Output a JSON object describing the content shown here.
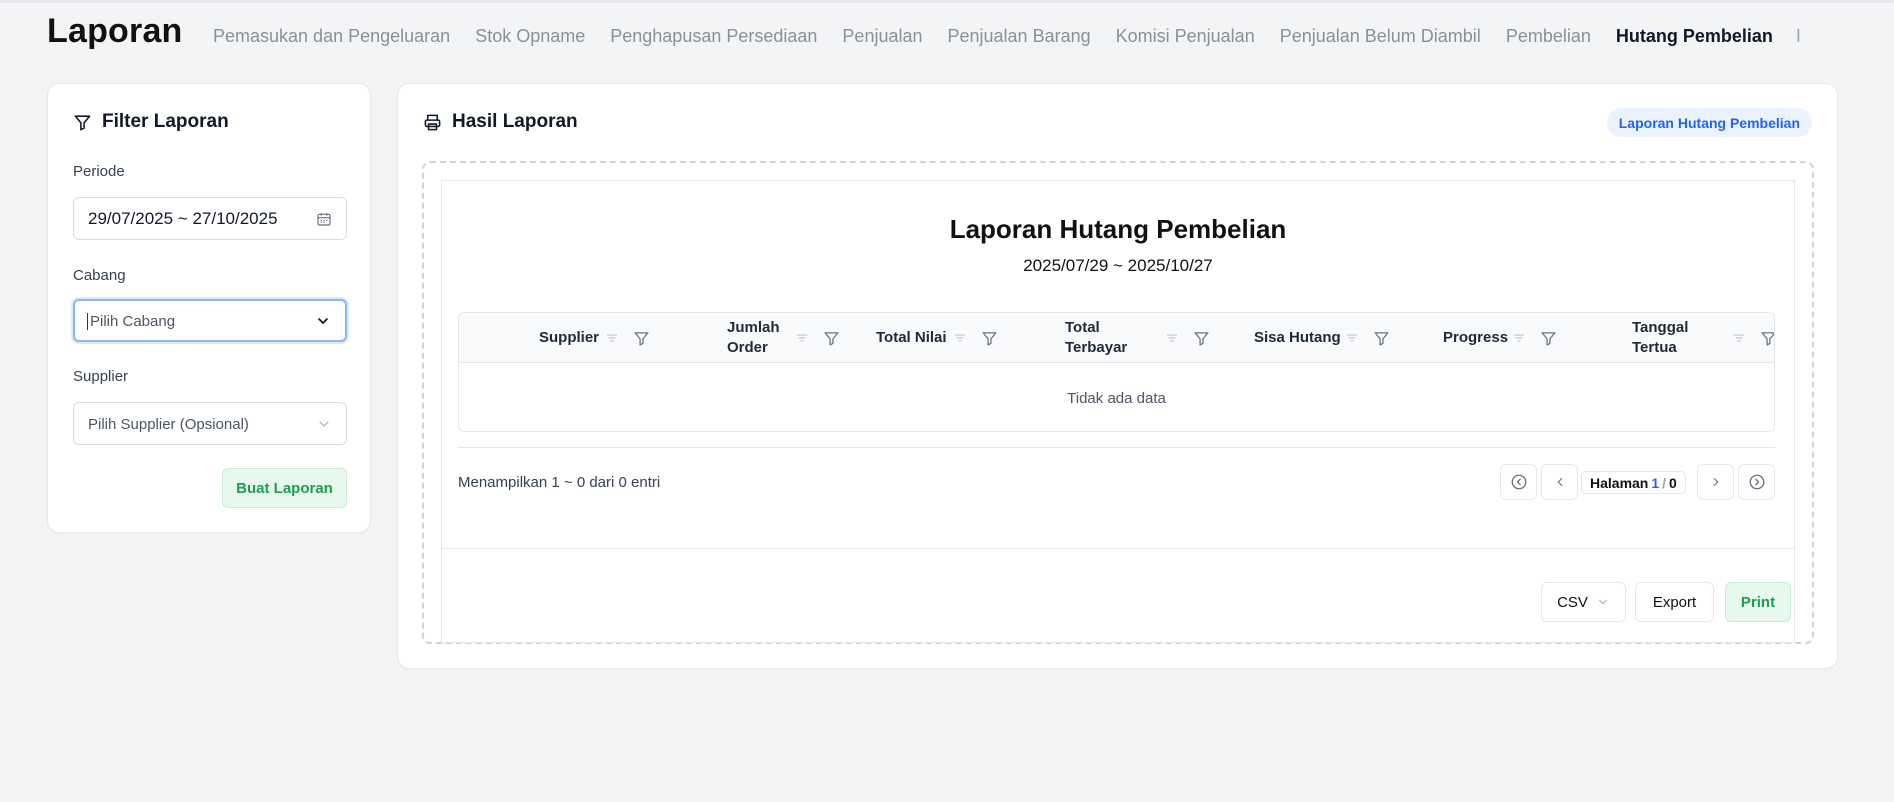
{
  "header": {
    "title": "Laporan",
    "nav": [
      {
        "label": "Pemasukan dan Pengeluaran",
        "active": false
      },
      {
        "label": "Stok Opname",
        "active": false
      },
      {
        "label": "Penghapusan Persediaan",
        "active": false
      },
      {
        "label": "Penjualan",
        "active": false
      },
      {
        "label": "Penjualan Barang",
        "active": false
      },
      {
        "label": "Komisi Penjualan",
        "active": false
      },
      {
        "label": "Penjualan Belum Diambil",
        "active": false
      },
      {
        "label": "Pembelian",
        "active": false
      },
      {
        "label": "Hutang Pembelian",
        "active": true
      }
    ],
    "nav_overflow": "I"
  },
  "filter": {
    "title": "Filter Laporan",
    "period_label": "Periode",
    "period_value": "29/07/2025 ~ 27/10/2025",
    "branch_label": "Cabang",
    "branch_placeholder": "Pilih Cabang",
    "supplier_label": "Supplier",
    "supplier_placeholder": "Pilih Supplier (Opsional)",
    "submit_label": "Buat Laporan"
  },
  "result": {
    "title": "Hasil Laporan",
    "badge": "Laporan Hutang Pembelian",
    "report_title": "Laporan Hutang Pembelian",
    "report_range": "2025/07/29 ~ 2025/10/27",
    "columns": [
      "Supplier",
      "Jumlah\nOrder",
      "Total Nilai",
      "Total\nTerbayar",
      "Sisa Hutang",
      "Progress",
      "Tanggal\nTertua"
    ],
    "empty_text": "Tidak ada data",
    "entries_text": "Menampilkan 1 ~ 0 dari 0 entri",
    "pager": {
      "label": "Halaman",
      "current": "1",
      "separator": "/",
      "total": "0"
    },
    "export_format": "CSV",
    "export_label": "Export",
    "print_label": "Print"
  },
  "colors": {
    "accent_blue": "#2563eb",
    "success_green": "#1f9d52",
    "background": "#f3f4f6"
  }
}
